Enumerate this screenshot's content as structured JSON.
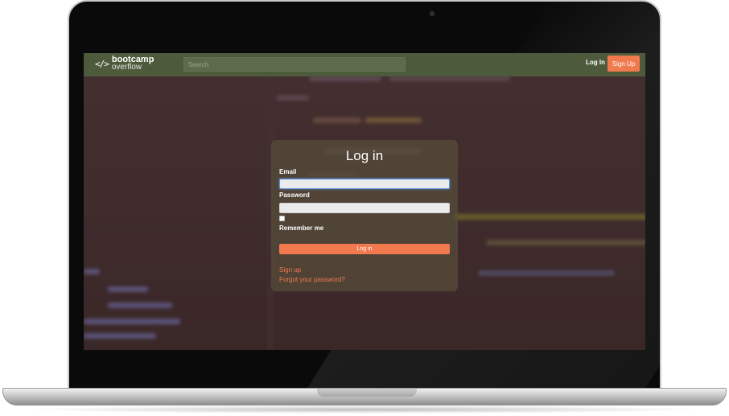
{
  "navbar": {
    "brand_main": "bootcamp",
    "brand_sub": "overflow",
    "brand_icon": "</>",
    "search_placeholder": "Search",
    "login_label": "Log In",
    "signup_label": "Sign Up"
  },
  "login_form": {
    "title": "Log in",
    "email_label": "Email",
    "email_value": "",
    "password_label": "Password",
    "password_value": "",
    "remember_label": "Remember me",
    "remember_checked": false,
    "submit_label": "Log in",
    "signup_link": "Sign up",
    "forgot_link": "Forgot your password?"
  },
  "colors": {
    "navbar_bg": "#4d5a3c",
    "accent": "#f0794e",
    "card_bg": "rgba(88,78,60,0.72)",
    "input_focus_border": "#5b8fd8"
  }
}
